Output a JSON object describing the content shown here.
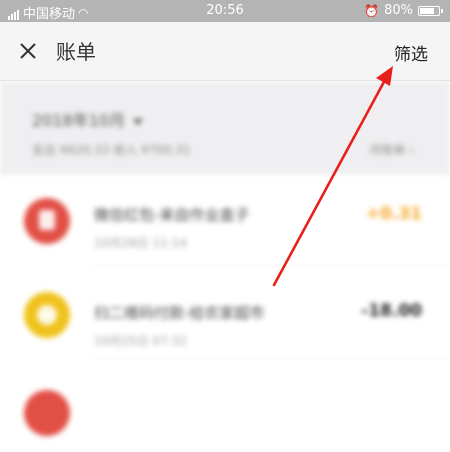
{
  "status_bar": {
    "carrier": "中国移动",
    "time": "20:56",
    "battery": "80%",
    "battery_level": 0.8
  },
  "header": {
    "title": "账单",
    "close_icon": "close-icon",
    "filter_label": "筛选"
  },
  "summary": {
    "month_label": "2018年10月",
    "totals_text": "支出 ¥620.33 收入 ¥700.31",
    "chart_link": "月账单 ›"
  },
  "transactions": [
    {
      "title": "微信红包-来自作业盒子",
      "time": "10月28日 11:14",
      "amount": "+0.31",
      "amount_color": "#f5a623",
      "icon_color": "#e24f45",
      "icon": "red-envelope-icon"
    },
    {
      "title": "扫二维码付款-给农家超市",
      "time": "10月25日 07:32",
      "amount": "-18.00",
      "amount_color": "#222222",
      "icon_color": "#f0c21b",
      "icon": "money-bag-icon"
    },
    {
      "title": "",
      "time": "",
      "amount": "",
      "amount_color": "#222222",
      "icon_color": "#e24f45",
      "icon": "red-envelope-icon"
    }
  ],
  "colors": {
    "annotation_arrow": "#e8201c",
    "header_bg": "#f5f5f5",
    "status_bar_bg": "#b4b4b4"
  }
}
